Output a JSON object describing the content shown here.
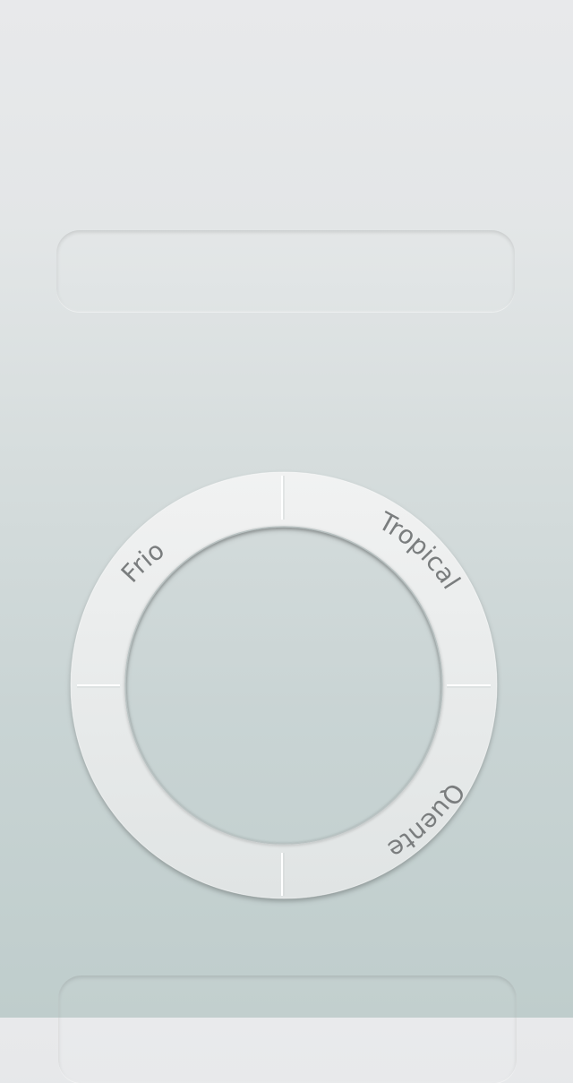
{
  "dial": {
    "labels": {
      "frio": "Frio",
      "tropical": "Tropical",
      "quente": "Quente"
    }
  },
  "colors": {
    "ring": "#eceeee",
    "label": "#7a7d7e"
  }
}
